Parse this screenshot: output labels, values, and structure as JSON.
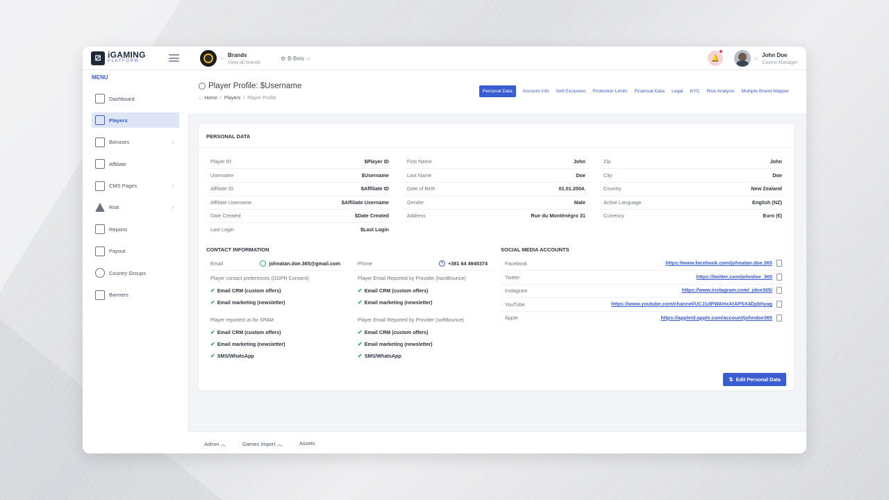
{
  "logo": {
    "main": "iGAMING",
    "sub": "PLATFORM"
  },
  "brands": {
    "title": "Brands",
    "subtitle": "View all brands",
    "bets": "B-Bets"
  },
  "user": {
    "name": "John Doe",
    "role": "Casino Manager"
  },
  "menu": {
    "header": "MENU",
    "items": [
      {
        "label": "Dashboard"
      },
      {
        "label": "Players"
      },
      {
        "label": "Bonuses"
      },
      {
        "label": "Affiliate"
      },
      {
        "label": "CMS Pages"
      },
      {
        "label": "Risk"
      },
      {
        "label": "Reports"
      },
      {
        "label": "Payout"
      },
      {
        "label": "Country Groups"
      },
      {
        "label": "Banners"
      }
    ]
  },
  "page": {
    "title": "Player Profile: $Username",
    "breadcrumb": [
      "Home",
      "Players",
      "Player Profile"
    ]
  },
  "tabs": [
    "Personal Data",
    "Account Info",
    "Self Exclusion",
    "Protection Limits",
    "Financial Data",
    "Legal",
    "KYC",
    "Risk Analysis",
    "Multiple Brand Mapper"
  ],
  "personal": {
    "heading": "PERSONAL DATA",
    "col1": [
      [
        "Player ID",
        "$Player ID"
      ],
      [
        "Username",
        "$Username"
      ],
      [
        "Affiliate ID",
        "$Affiliate ID"
      ],
      [
        "Affiliate Username",
        "$Affiliate Username"
      ],
      [
        "Date Created",
        "$Date Created"
      ],
      [
        "Last Login",
        "$Last Login"
      ]
    ],
    "col2": [
      [
        "First Name",
        "John"
      ],
      [
        "Last Name",
        "Doe"
      ],
      [
        "Date of Birth",
        "01.01.2004."
      ],
      [
        "Gender",
        "Male"
      ],
      [
        "Address",
        "Rue du Monténégro 31"
      ]
    ],
    "col3": [
      [
        "Zip",
        "John"
      ],
      [
        "City",
        "Doe"
      ],
      [
        "Country",
        "New Zealand"
      ],
      [
        "Active Language",
        "English (NZ)"
      ],
      [
        "Currency",
        "Euro (€)"
      ]
    ]
  },
  "contact": {
    "heading": "CONTACT INFORMATION",
    "email_label": "Email",
    "email": "johnatan.doe.365@gmail.com",
    "phone_label": "Phone",
    "phone": "+381 64 4945374",
    "gdpr": "Player contact preferences (GDPR Consent)",
    "hard": "Player Email Reported by Provider (hardBounce)",
    "spam": "Player reported us for SPAM",
    "soft": "Player Email Reported by Provider (softBounce)",
    "crm": "Email CRM (custom offers)",
    "newsletter": "Email marketing (newsletter)",
    "sms": "SMS/WhatsApp"
  },
  "social": {
    "heading": "SOCIAL MEDIA ACCOUNTS",
    "items": [
      [
        "Facebook",
        "https://www.facebook.com/johnatan.doe.365"
      ],
      [
        "Twitter",
        "https://twitter.com/johndoe_365"
      ],
      [
        "Instagram",
        "https://www.instagram.com/_jdoe365/"
      ],
      [
        "YouTube",
        "https://www.youtube.com/channel/UCJ1dPWAHxAtAPSX4Dpbhyag"
      ],
      [
        "Apple",
        "https://appleid.apple.com/account/johndoe365"
      ]
    ]
  },
  "edit_button": "Edit Personal Data",
  "footer": [
    "Admin",
    "Games Import",
    "Assets"
  ]
}
